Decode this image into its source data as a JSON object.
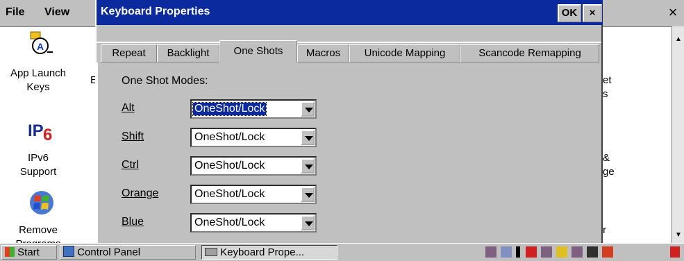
{
  "background_window": {
    "menu": [
      "File",
      "View"
    ],
    "close_label": "×",
    "items": [
      {
        "label_line1": "App Launch",
        "label_line2": "Keys",
        "icon": "app-launch-keys-icon"
      },
      {
        "label_line1": "IPv6",
        "label_line2": "Support",
        "icon": "ipv6-icon"
      },
      {
        "label_line1": "Remove",
        "label_line2": "Programs",
        "icon": "windows-flag-icon"
      }
    ],
    "right_fragments": [
      "et",
      "s",
      "&",
      "ge",
      "r"
    ],
    "left_fragment": "E"
  },
  "dialog": {
    "title": "Keyboard Properties",
    "ok_label": "OK",
    "close_label": "×",
    "tabs": [
      "Repeat",
      "Backlight",
      "One Shots",
      "Macros",
      "Unicode Mapping",
      "Scancode Remapping"
    ],
    "active_tab": "One Shots",
    "section_label": "One Shot Modes:",
    "rows": [
      {
        "label": "Alt",
        "value": "OneShot/Lock"
      },
      {
        "label": "Shift",
        "value": "OneShot/Lock"
      },
      {
        "label": "Ctrl",
        "value": "OneShot/Lock"
      },
      {
        "label": "Orange",
        "value": "OneShot/Lock"
      },
      {
        "label": "Blue",
        "value": "OneShot/Lock"
      }
    ]
  },
  "taskbar": {
    "start_label": "Start",
    "tasks": [
      "Control Panel",
      "Keyboard Prope..."
    ]
  },
  "colors": {
    "titlebar": "#0a2a9e",
    "chrome": "#c0c0c0"
  }
}
